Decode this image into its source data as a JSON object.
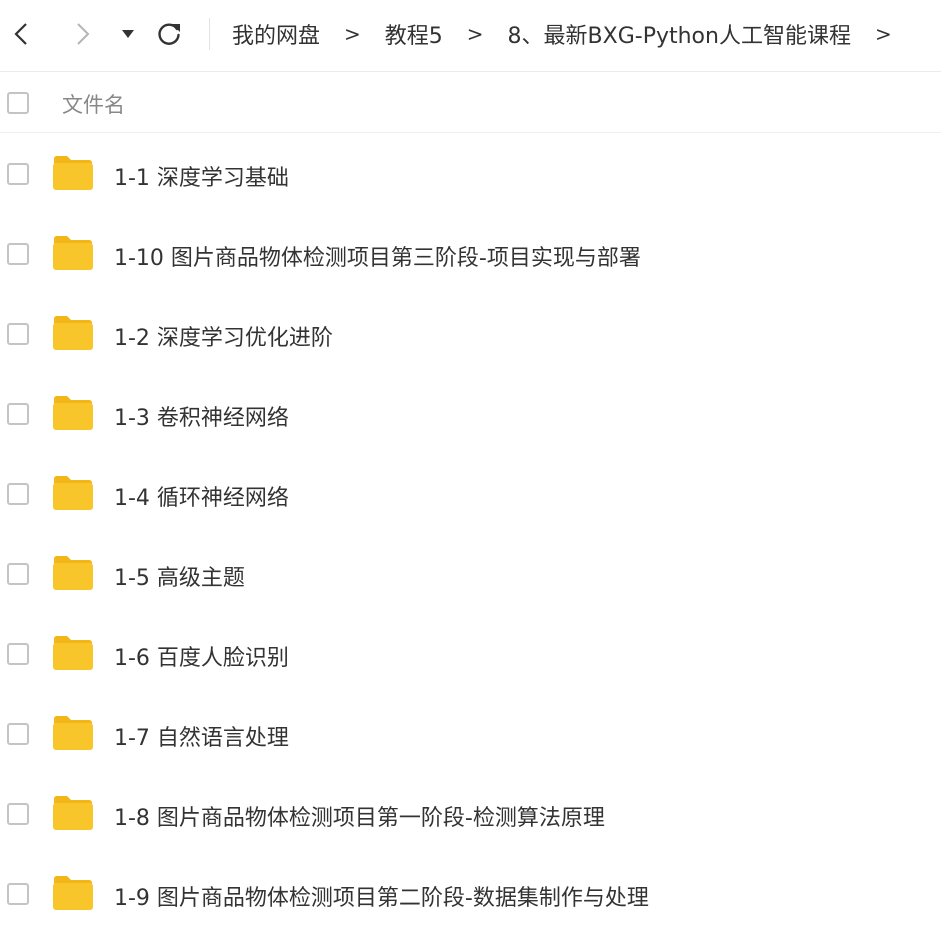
{
  "toolbar": {
    "back_icon": "chevron-left-icon",
    "forward_icon": "chevron-right-icon",
    "dropdown_icon": "caret-down-icon",
    "refresh_icon": "refresh-icon",
    "breadcrumb": [
      "我的网盘",
      "教程5",
      "8、最新BXG-Python人工智能课程"
    ],
    "separator": ">"
  },
  "header": {
    "column_label": "文件名"
  },
  "colors": {
    "folder": "#f8c62b",
    "folder_tab": "#f2b619",
    "checkbox_border": "#c4c4c4",
    "text": "#333333",
    "header_text": "#888888"
  },
  "files": [
    {
      "name": "1-1 深度学习基础",
      "type": "folder"
    },
    {
      "name": "1-10 图片商品物体检测项目第三阶段-项目实现与部署",
      "type": "folder"
    },
    {
      "name": "1-2 深度学习优化进阶",
      "type": "folder"
    },
    {
      "name": "1-3 卷积神经网络",
      "type": "folder"
    },
    {
      "name": "1-4 循环神经网络",
      "type": "folder"
    },
    {
      "name": "1-5 高级主题",
      "type": "folder"
    },
    {
      "name": "1-6 百度人脸识别",
      "type": "folder"
    },
    {
      "name": "1-7 自然语言处理",
      "type": "folder"
    },
    {
      "name": "1-8 图片商品物体检测项目第一阶段-检测算法原理",
      "type": "folder"
    },
    {
      "name": "1-9 图片商品物体检测项目第二阶段-数据集制作与处理",
      "type": "folder"
    }
  ]
}
